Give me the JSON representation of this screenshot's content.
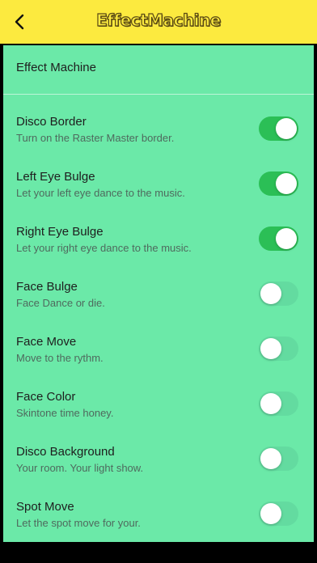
{
  "header": {
    "title": "EffectMachine",
    "back_icon": "chevron-left-icon"
  },
  "panel": {
    "heading": "Effect Machine"
  },
  "settings": [
    {
      "title": "Disco Border",
      "subtitle": "Turn on the Raster Master border.",
      "enabled": true
    },
    {
      "title": "Left Eye Bulge",
      "subtitle": "Let your left eye dance to the music.",
      "enabled": true
    },
    {
      "title": "Right Eye Bulge",
      "subtitle": "Let your right eye dance to the music.",
      "enabled": true
    },
    {
      "title": "Face Bulge",
      "subtitle": "Face Dance or die.",
      "enabled": false
    },
    {
      "title": "Face Move",
      "subtitle": "Move to the rythm.",
      "enabled": false
    },
    {
      "title": "Face Color",
      "subtitle": "Skintone time honey.",
      "enabled": false
    },
    {
      "title": "Disco Background",
      "subtitle": "Your room. Your light show.",
      "enabled": false
    },
    {
      "title": "Spot Move",
      "subtitle": "Let the spot move for your.",
      "enabled": false
    }
  ],
  "colors": {
    "header_bg": "#fcea3f",
    "panel_bg": "#6be9a8",
    "toggle_on": "#2bbf56",
    "toggle_off": "#63dba0"
  }
}
